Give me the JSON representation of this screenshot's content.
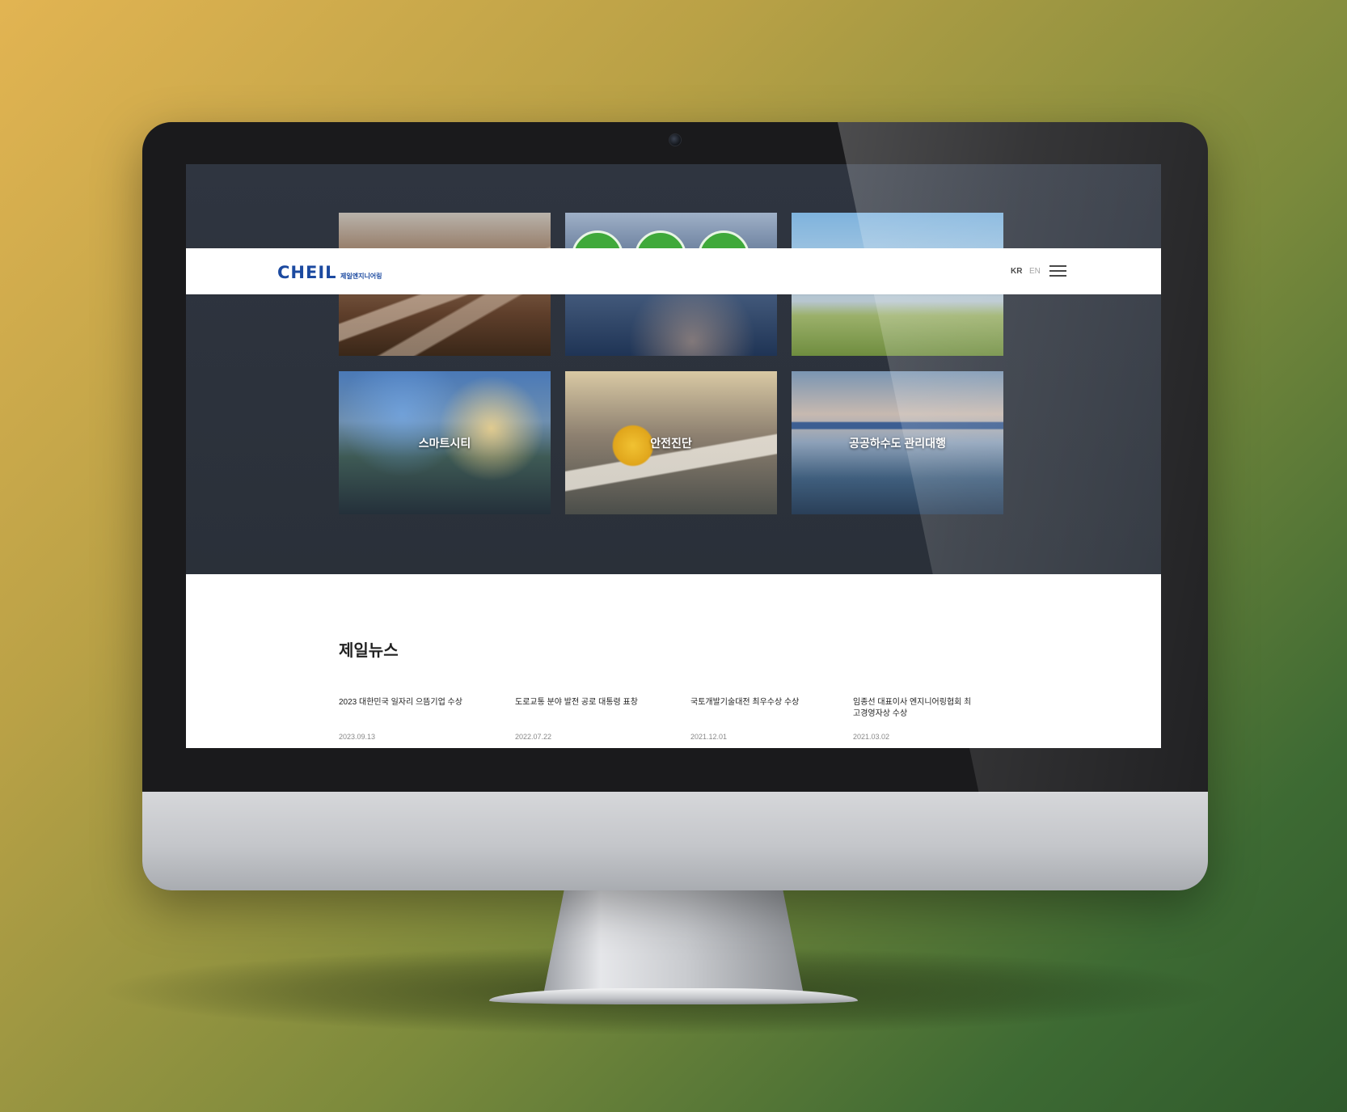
{
  "header": {
    "logo_en": "CHEIL",
    "logo_kr": "제일엔지니어링",
    "lang_kr": "KR",
    "lang_en": "EN"
  },
  "business_tiles": [
    {
      "label": ""
    },
    {
      "label": ""
    },
    {
      "label": ""
    },
    {
      "label": "스마트시티"
    },
    {
      "label": "안전진단"
    },
    {
      "label": "공공하수도 관리대행"
    }
  ],
  "news": {
    "title": "제일뉴스",
    "items": [
      {
        "headline": "2023 대한민국 일자리 으뜸기업 수상",
        "date": "2023.09.13"
      },
      {
        "headline": "도로교통 분야 발전 공로 대통령 표창",
        "date": "2022.07.22"
      },
      {
        "headline": "국토개발기술대전 최우수상 수상",
        "date": "2021.12.01"
      },
      {
        "headline": "임종선 대표이사 엔지니어링협회 최고경영자상 수상",
        "date": "2021.03.02"
      }
    ]
  },
  "colors": {
    "brand_blue": "#1c4aa0",
    "brand_green": "#4aa84a",
    "hero_bg": "#2d333d"
  }
}
